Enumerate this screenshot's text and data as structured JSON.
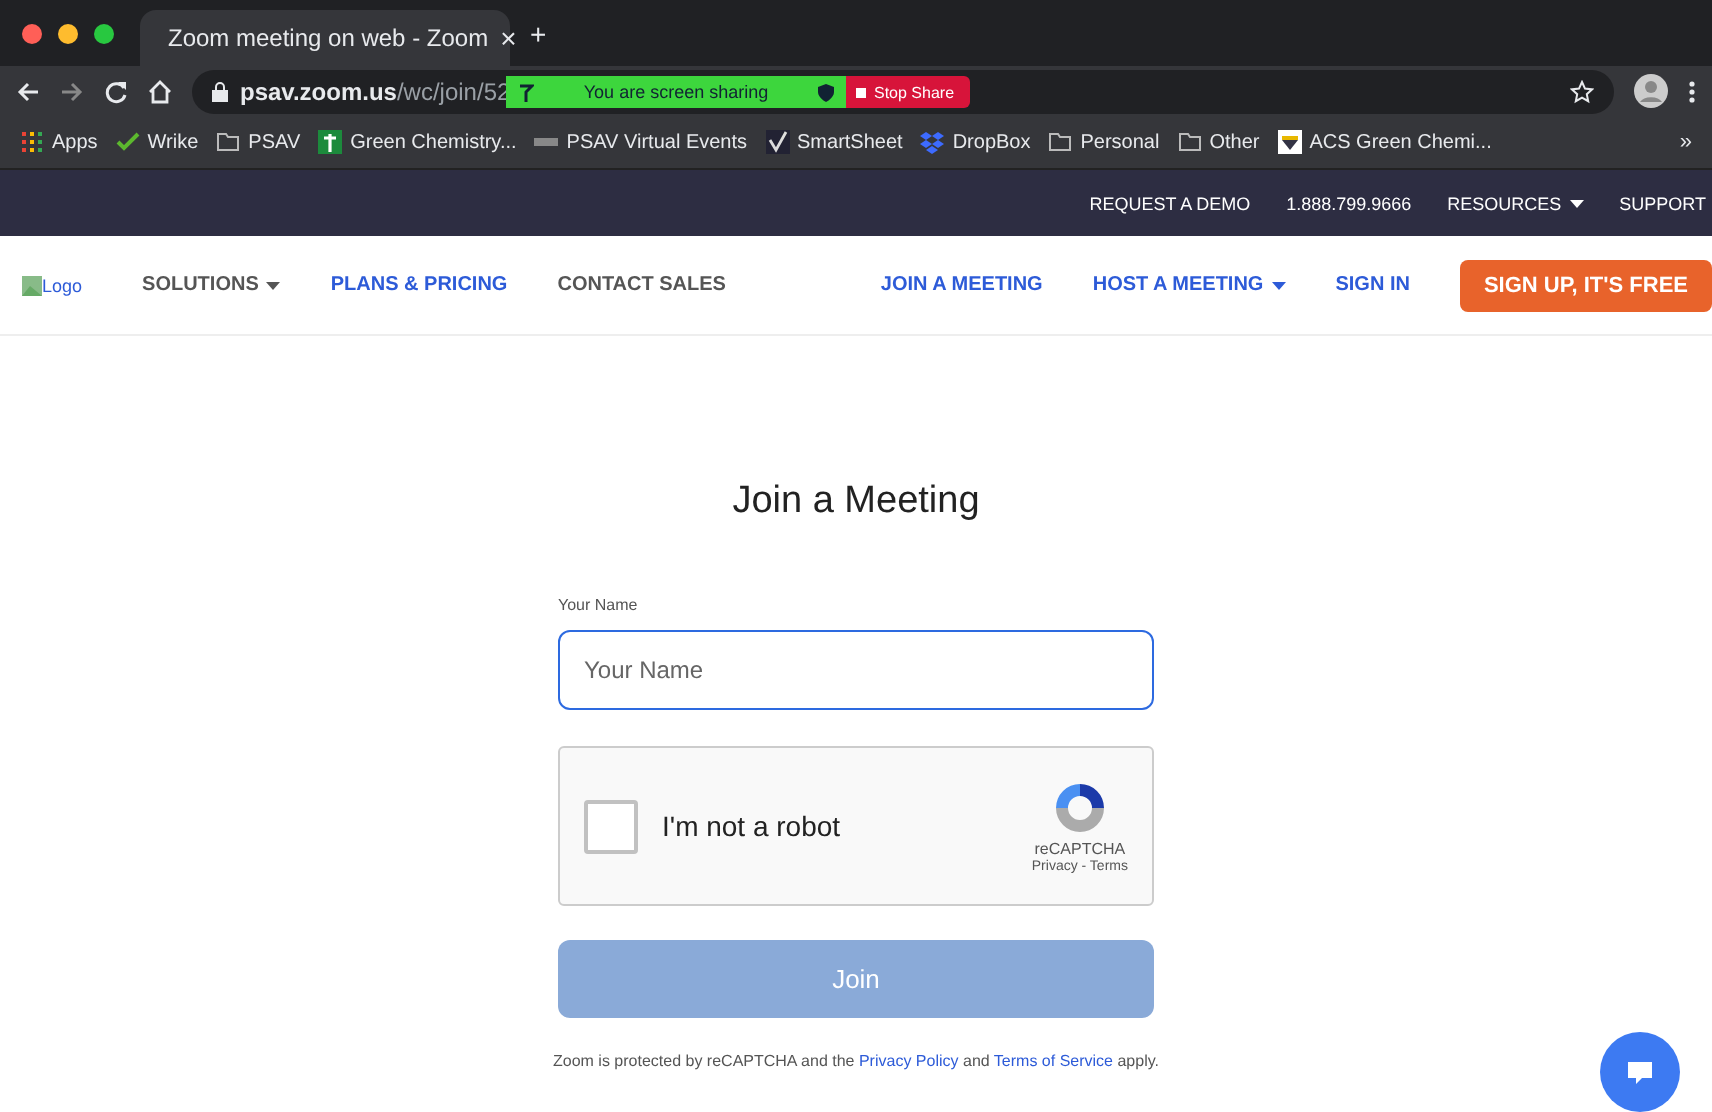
{
  "browser": {
    "tab": {
      "title": "Zoom meeting on web - Zoom",
      "close": "×"
    },
    "new_tab": "+",
    "url": {
      "host": "psav.zoom.us",
      "path": "/wc/join/52"
    },
    "sharing_bar": {
      "message": "You are screen sharing",
      "stop": "Stop Share"
    },
    "bookmarks": [
      {
        "label": "Apps",
        "kind": "apps"
      },
      {
        "label": "Wrike",
        "kind": "check"
      },
      {
        "label": "PSAV",
        "kind": "folder"
      },
      {
        "label": "Green Chemistry...",
        "kind": "cross"
      },
      {
        "label": "PSAV Virtual Events",
        "kind": "event"
      },
      {
        "label": "SmartSheet",
        "kind": "tick"
      },
      {
        "label": "DropBox",
        "kind": "dropbox"
      },
      {
        "label": "Personal",
        "kind": "folder"
      },
      {
        "label": "Other",
        "kind": "folder"
      },
      {
        "label": "ACS Green Chemi...",
        "kind": "acs"
      }
    ],
    "more": "»"
  },
  "top_bar": [
    {
      "label": "REQUEST A DEMO",
      "dropdown": false
    },
    {
      "label": "1.888.799.9666",
      "dropdown": false
    },
    {
      "label": "RESOURCES",
      "dropdown": true
    },
    {
      "label": "SUPPORT",
      "dropdown": false
    }
  ],
  "nav": {
    "logo": "Logo",
    "left": [
      {
        "label": "SOLUTIONS",
        "dropdown": true,
        "color": "#555555"
      },
      {
        "label": "PLANS & PRICING",
        "dropdown": false,
        "color": "#2d5bd8"
      },
      {
        "label": "CONTACT SALES",
        "dropdown": false,
        "color": "#555555"
      }
    ],
    "right": [
      {
        "label": "JOIN A MEETING",
        "dropdown": false,
        "color": "#2d5bd8"
      },
      {
        "label": "HOST A MEETING",
        "dropdown": true,
        "color": "#2d5bd8"
      },
      {
        "label": "SIGN IN",
        "dropdown": false,
        "color": "#2d5bd8"
      }
    ],
    "signup": "SIGN UP, IT'S FREE"
  },
  "form": {
    "title": "Join a Meeting",
    "name_label": "Your Name",
    "name_placeholder": "Your Name",
    "captcha": {
      "label": "I'm not a robot",
      "checked": false,
      "brand": "reCAPTCHA",
      "links": "Privacy - Terms"
    },
    "join": {
      "label": "Join",
      "disabled": true
    },
    "notice": [
      {
        "kind": "text",
        "text": "Zoom is protected by reCAPTCHA and the "
      },
      {
        "kind": "link",
        "text": "Privacy Policy"
      },
      {
        "kind": "text",
        "text": " and "
      },
      {
        "kind": "link",
        "text": "Terms of Service"
      },
      {
        "kind": "text",
        "text": " apply."
      }
    ]
  }
}
